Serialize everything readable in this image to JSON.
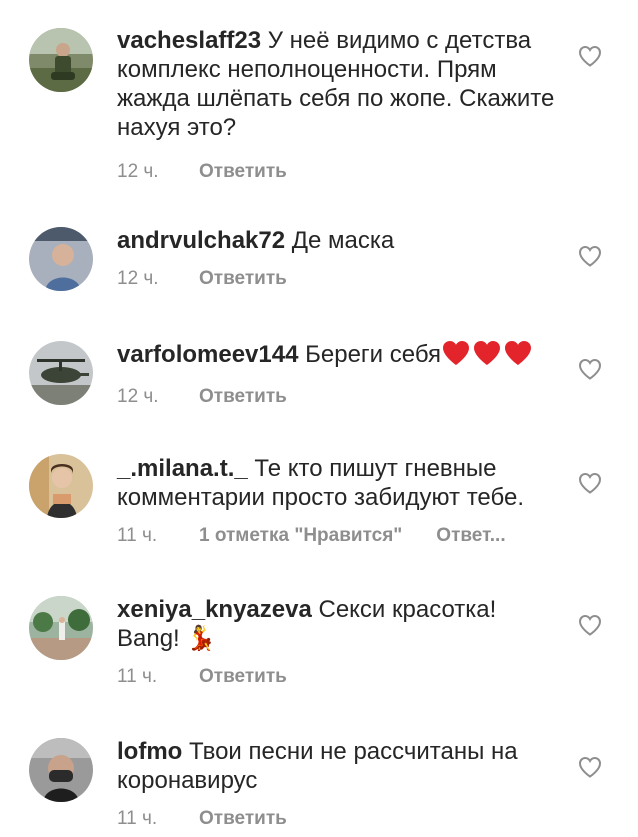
{
  "comments": [
    {
      "username": "vacheslaff23",
      "text": " У неё видимо с детства комплекс неполноценности. Прям жажда шлёпать себя по жопе. Скажите нахуя это?",
      "time": "12 ч.",
      "reply": "Ответить",
      "avatar": "avatar-man-outdoor"
    },
    {
      "username": "andrvulchak72",
      "text": " Де маска",
      "time": "12 ч.",
      "reply": "Ответить",
      "avatar": "avatar-man-portrait"
    },
    {
      "username": "varfolomeev144",
      "text": " Береги себя",
      "emoji": "❤❤❤",
      "time": "12 ч.",
      "reply": "Ответить",
      "avatar": "avatar-helicopter"
    },
    {
      "username": "_.milana.t._",
      "text": " Те кто пишут гневные комментарии просто забидуют тебе.",
      "time": "11 ч.",
      "likes": "1 отметка \"Нравится\"",
      "reply": "Ответ...",
      "avatar": "avatar-girl"
    },
    {
      "username": "xeniya_knyazeva",
      "text": " Секси красотка! Bang! ",
      "emoji": "💃",
      "time": "11 ч.",
      "reply": "Ответить",
      "avatar": "avatar-garden"
    },
    {
      "username": "lofmo",
      "text": " Твои песни не рассчитаны на коронавирус",
      "time": "11 ч.",
      "reply": "Ответить",
      "avatar": "avatar-man-mask"
    }
  ],
  "colors": {
    "text": "#262626",
    "secondary": "#8e8e8e",
    "heart_stroke": "#8e8e8e",
    "emoji_red": "#e3242b"
  }
}
